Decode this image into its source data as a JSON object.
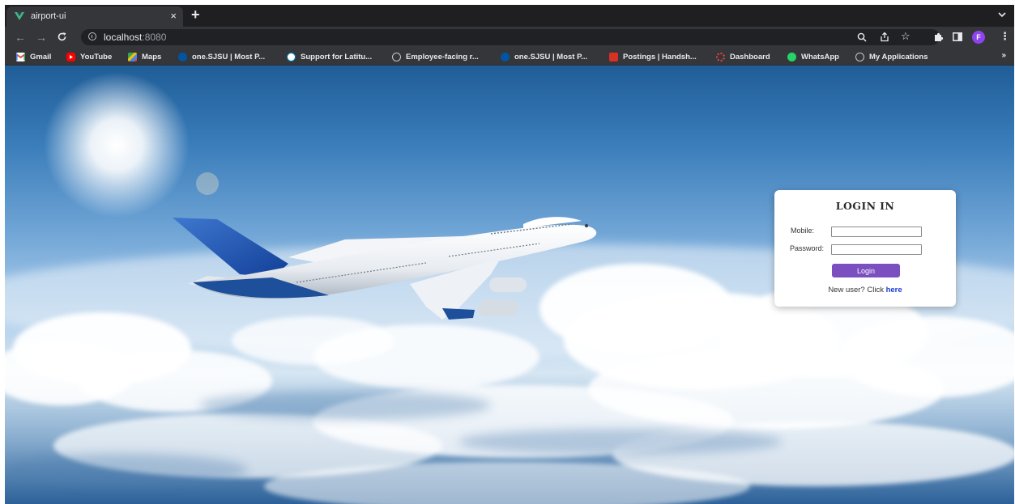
{
  "browser": {
    "tab": {
      "title": "airport-ui",
      "close_glyph": "×",
      "favicon": "vue-logo-icon"
    },
    "new_tab_glyph": "+",
    "tab_search_icon": "chevron-down-icon",
    "url": {
      "host": "localhost",
      "port": ":8080"
    },
    "profile_initial": "F",
    "bookmarks": [
      {
        "label": "Gmail",
        "icon": "gmail-icon",
        "color": "#ea4335"
      },
      {
        "label": "YouTube",
        "icon": "youtube-icon",
        "color": "#ff0000"
      },
      {
        "label": "Maps",
        "icon": "maps-icon",
        "color": "#34a853"
      },
      {
        "label": "one.SJSU | Most P...",
        "icon": "sjsu-icon",
        "color": "#0055a2"
      },
      {
        "label": "Support for Latitu...",
        "icon": "dell-icon",
        "color": "#007db8"
      },
      {
        "label": "Employee-facing r...",
        "icon": "globe-icon",
        "color": "#9aa0a6"
      },
      {
        "label": "one.SJSU | Most P...",
        "icon": "sjsu-icon",
        "color": "#0055a2"
      },
      {
        "label": "Postings | Handsh...",
        "icon": "handshake-icon",
        "color": "#d93025"
      },
      {
        "label": "Dashboard",
        "icon": "dashboard-icon",
        "color": "#e8453c"
      },
      {
        "label": "WhatsApp",
        "icon": "whatsapp-icon",
        "color": "#25d366"
      },
      {
        "label": "My Applications",
        "icon": "globe-icon",
        "color": "#9aa0a6"
      }
    ],
    "bookmarks_more": "»"
  },
  "login": {
    "title": "LOGIN IN",
    "mobile_label": "Mobile:",
    "mobile_value": "",
    "password_label": "Password:",
    "password_value": "",
    "button_label": "Login",
    "register_prefix": "New user? Click ",
    "register_link": "here"
  },
  "colors": {
    "accent": "#7b4fc0",
    "link": "#1a3bd6",
    "browser_dark": "#35363a"
  }
}
